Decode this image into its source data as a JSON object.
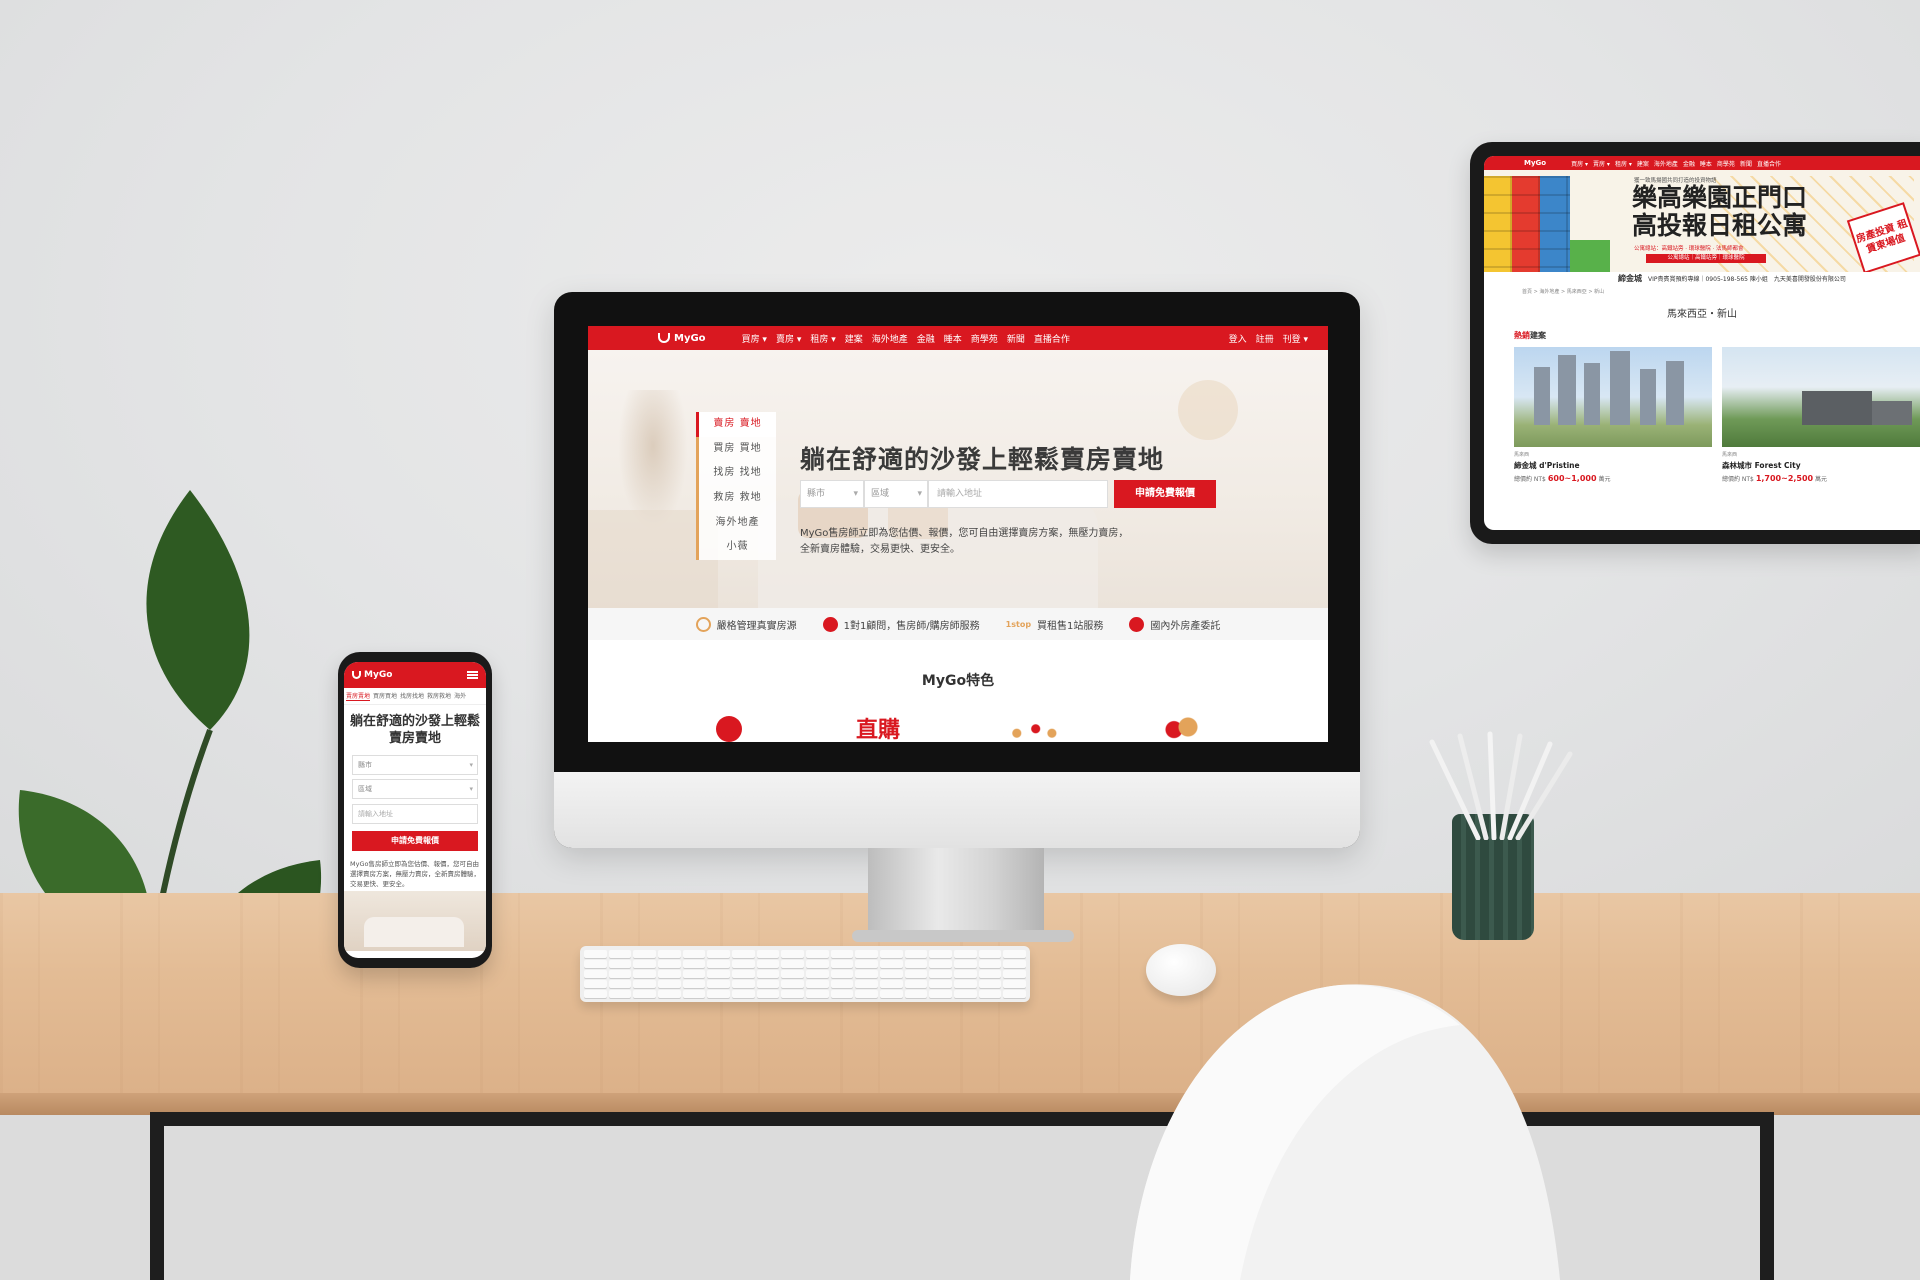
{
  "colors": {
    "brand": "#d91820",
    "accent": "#e3a35a"
  },
  "desktop": {
    "brand": "MyGo",
    "nav": [
      "買房 ▾",
      "賣房 ▾",
      "租房 ▾",
      "建案",
      "海外地產",
      "金融",
      "睡本",
      "商學苑",
      "新聞",
      "直播合作"
    ],
    "nav_right": [
      "登入",
      "註冊",
      "刊登 ▾"
    ],
    "side_menu": [
      "賣房 賣地",
      "買房 買地",
      "找房 找地",
      "救房 救地",
      "海外地產",
      "小薇"
    ],
    "hero_title": "躺在舒適的沙發上輕鬆賣房賣地",
    "search": {
      "city": "縣市",
      "district": "區域",
      "address_placeholder": "請輸入地址",
      "cta": "申請免費報價"
    },
    "description": "MyGo售房師立即為您估價、報價，您可自由選擇賣房方案，無壓力賣房，全新賣房體驗，交易更快、更安全。",
    "features": [
      {
        "icon": "shield-icon",
        "text": "嚴格管理真實房源"
      },
      {
        "icon": "person-icon",
        "text": "1對1顧問，售房師/購房師服務"
      },
      {
        "icon": "1stop-icon",
        "prefix": "1stop",
        "text": "買租售1站服務"
      },
      {
        "icon": "globe-icon",
        "text": "國內外房產委託"
      }
    ],
    "section_title": "MyGo特色",
    "feature_glyph": "直購"
  },
  "mobile": {
    "brand": "MyGo",
    "tabs": [
      "賣房賣地",
      "買房買地",
      "找房找地",
      "救房救地",
      "海外"
    ],
    "title": "躺在舒適的沙發上輕鬆賣房賣地",
    "city": "縣市",
    "district": "區域",
    "address_placeholder": "請輸入地址",
    "cta": "申請免費報價",
    "description": "MyGo售房師立即為您估價、報價，您可自由選擇賣房方案，無壓力賣房，全新賣房體驗，交易更快、更安全。"
  },
  "tablet": {
    "brand": "MyGo",
    "nav": [
      "買房 ▾",
      "賣房 ▾",
      "租房 ▾",
      "建案",
      "海外地產",
      "金融",
      "睡本",
      "商學苑",
      "新聞",
      "直播合作"
    ],
    "banner_top": "獲一致馬揚國共同打造的投資物語",
    "banner_line1": "樂高樂園正門口",
    "banner_line2": "高投報日租公寓",
    "banner_sub": "公寓總站：高鐵站旁 ‧ 環球醫院 ‧ 法馬師都會",
    "banner_pill": "公寓總站｜高鐵站旁｜環球醫院",
    "badge": "房產投資\n租賃東場值",
    "footer_name": "締金城",
    "footer_text": "VIP貴賓賞預約專線｜0905-198-565 陳小姐",
    "footer_company": "九天美喜開發股份有限公司",
    "breadcrumb": "首頁 > 海外地產 > 馬來西亞 > 新山",
    "region": "馬來西亞・新山",
    "hot_prefix": "熱銷",
    "hot_suffix": "建案",
    "cards": [
      {
        "tag": "馬來西",
        "name": "締金城 d'Pristine",
        "price_label": "總價約 NT$",
        "price": "600~1,000",
        "unit": "萬元"
      },
      {
        "tag": "馬來西",
        "name": "森林城市 Forest City",
        "price_label": "總價約 NT$",
        "price": "1,700~2,500",
        "unit": "萬元"
      }
    ]
  }
}
